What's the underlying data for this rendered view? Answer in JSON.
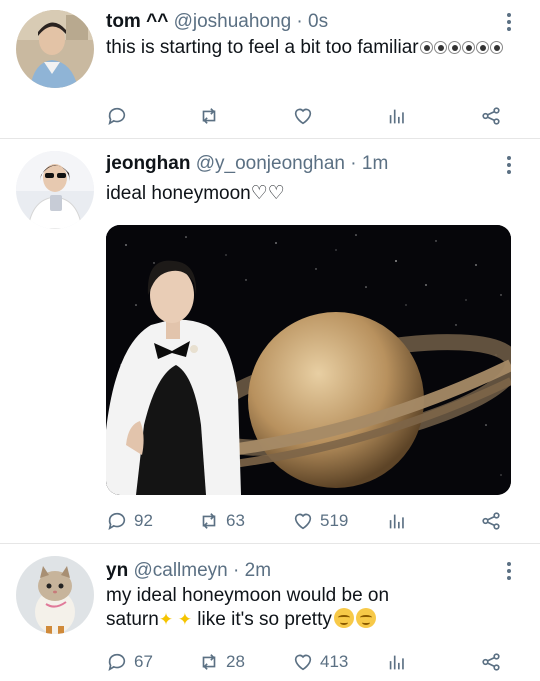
{
  "tweets": [
    {
      "name": "tom ^^",
      "handle": "@joshuahong",
      "dot": "·",
      "time": "0s",
      "text": "this is starting to feel a bit too familiar",
      "reply_count": "",
      "retweet_count": "",
      "like_count": ""
    },
    {
      "name": "jeonghan",
      "handle": "@y_oonjeonghan",
      "dot": "·",
      "time": "1m",
      "text": "ideal honeymoon♡♡",
      "reply_count": "92",
      "retweet_count": "63",
      "like_count": "519"
    },
    {
      "name": "yn",
      "handle": "@callmeyn",
      "dot": "·",
      "time": "2m",
      "text_line1": "my ideal honeymoon would be on",
      "text_line2_a": "saturn",
      "text_line2_b": " like it's so pretty",
      "reply_count": "67",
      "retweet_count": "28",
      "like_count": "413"
    }
  ],
  "icons": {
    "reply": "reply-icon",
    "retweet": "retweet-icon",
    "like": "heart-icon",
    "analytics": "analytics-icon",
    "share": "share-icon",
    "more": "more-options-icon"
  },
  "colors": {
    "secondary_text": "#5b7083",
    "primary_text": "#0f1419",
    "divider": "#e6e6e6"
  }
}
